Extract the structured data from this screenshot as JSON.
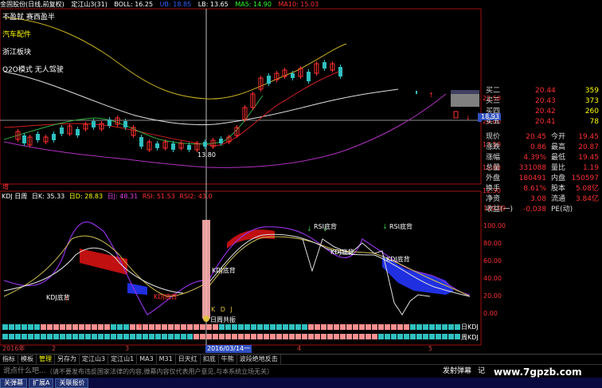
{
  "header": {
    "stock": "金固股份(日线,前复权)",
    "indicator": "定江山3(31)",
    "boll": "BOLL: 16.25",
    "ub": "UB: 18.85",
    "lb": "LB: 13.65",
    "ma5": "MA5: 14.90",
    "ma10": "MA10: 15.03"
  },
  "left_labels": [
    "不盈就 赛西盈半",
    "汽车配件",
    "浙江板块",
    "O2O模式 无人驾驶"
  ],
  "kdj_header": {
    "label": "KDJ 日周",
    "k": "日K: 35.33",
    "d": "日D: 28.83",
    "j": "日J: 48.31",
    "rsi": "RSI: 51.53",
    "rsi2": "RSI2: 43.0"
  },
  "annotations": {
    "kdj_bottom1": "KDJ底背",
    "kdj_bottom2": "KDJ底背",
    "kdj_bottom3": "KDJ底背",
    "kdj_bottom4": "KDJ底背",
    "rsi_bottom": "RSI底背",
    "rsi_bottom2": "RSI底背",
    "day_week": "日周共振",
    "kdj_text": "K D J",
    "low_price": "13.80",
    "prefix_bei": "增",
    "day_kdj": "日KDJ",
    "week_kdj": "周KDJ",
    "kdj_small": "KDJ底背"
  },
  "price_axis": [
    "22.50",
    "20.00",
    "17.50",
    "15.00",
    "12.50",
    "10.00"
  ],
  "price_mark": "18.93",
  "kdj_axis": [
    "120.00",
    "100.00",
    "80.00",
    "60.00",
    "40.00",
    "20.00",
    "0.00"
  ],
  "quote": {
    "asks": [
      {
        "label": "买二",
        "price": "20.44",
        "vol": "359"
      },
      {
        "label": "买三",
        "price": "20.43",
        "vol": "373"
      },
      {
        "label": "买四",
        "price": "20.42",
        "vol": "260"
      },
      {
        "label": "买五",
        "price": "20.41",
        "vol": "78"
      }
    ],
    "rows": [
      {
        "l1": "现价",
        "v1": "20.45",
        "l2": "今开",
        "v2": "19.45"
      },
      {
        "l1": "涨跌",
        "v1": "0.86",
        "l2": "最高",
        "v2": "20.87"
      },
      {
        "l1": "涨幅",
        "v1": "4.39%",
        "l2": "最低",
        "v2": "19.45"
      },
      {
        "l1": "总量",
        "v1": "331088",
        "l2": "量比",
        "v2": "1.19"
      },
      {
        "l1": "外盘",
        "v1": "180491",
        "l2": "内盘",
        "v2": "150597"
      },
      {
        "l1": "换手",
        "v1": "8.61%",
        "l2": "股本",
        "v2": "5.08亿"
      },
      {
        "l1": "净资",
        "v1": "3.08",
        "l2": "流通",
        "v2": "3.84亿"
      },
      {
        "l1": "收益(一)",
        "v1": "-0.038",
        "l2": "PE(动)",
        "v2": ""
      }
    ]
  },
  "time_axis": {
    "year": "2016年",
    "m2": "2",
    "m3": "3",
    "date": "2016/03/14一",
    "m4": "4",
    "m5": "5"
  },
  "tabs": [
    "指标",
    "模板",
    "管理",
    "另存为",
    "定江山3",
    "定江山1",
    "MA3",
    "M31",
    "日天红",
    "扣底",
    "牛熊",
    "波段绝地反击"
  ],
  "status": {
    "left": "说点什么吧...",
    "notice": "（请不要发布违反国家法律的内容,微幕内容仅代表用户意见,与本系统立场无关）",
    "send": "发射弹幕",
    "right": "记"
  },
  "taskbar": [
    "关弹幕",
    "扩展A",
    "关联报价"
  ],
  "watermark": "www.7gpzb.com",
  "colors": {
    "up": "#ff3030",
    "down": "#30c0c0",
    "yellow": "#ffff00",
    "magenta": "#e040e0",
    "purple": "#8020c0",
    "blue": "#2030e0",
    "red_fill": "#c01010"
  }
}
